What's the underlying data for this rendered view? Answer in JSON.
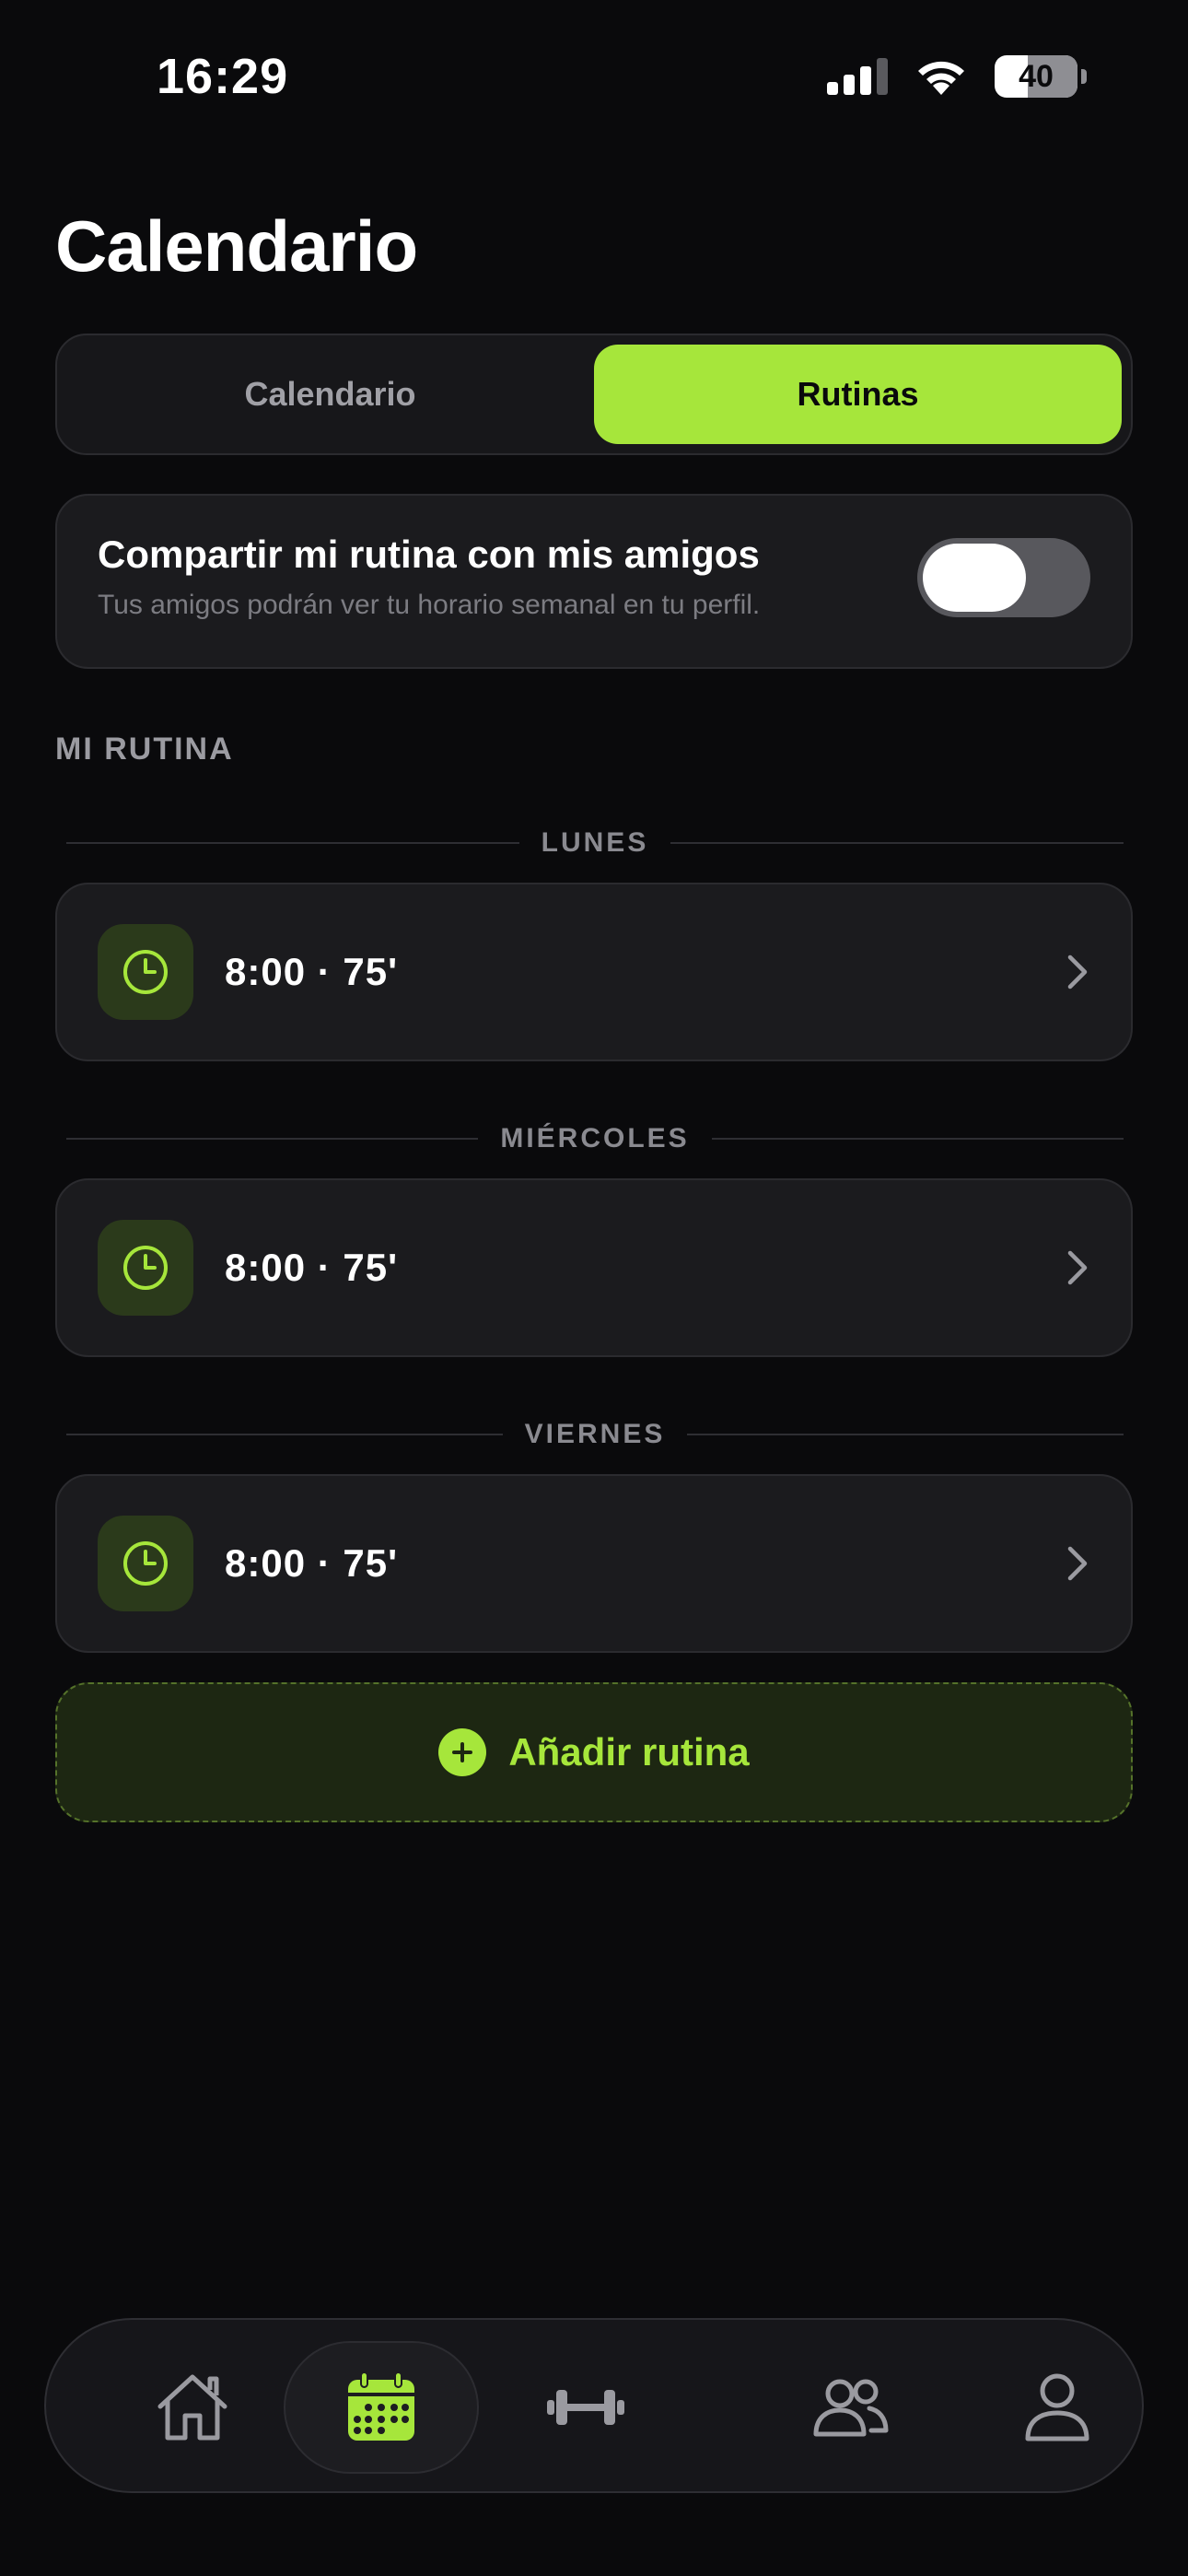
{
  "status_bar": {
    "time": "16:29",
    "battery_percent": "40",
    "battery_level": 40
  },
  "header": {
    "title": "Calendario"
  },
  "segmented": {
    "tabs": [
      {
        "label": "Calendario",
        "active": false
      },
      {
        "label": "Rutinas",
        "active": true
      }
    ]
  },
  "share": {
    "title": "Compartir mi rutina con mis amigos",
    "subtitle": "Tus amigos podrán ver tu horario semanal en tu perfil.",
    "enabled": false
  },
  "routine_section": {
    "label": "MI RUTINA",
    "days": [
      {
        "day": "LUNES",
        "time": "8:00 · 75'"
      },
      {
        "day": "MIÉRCOLES",
        "time": "8:00 · 75'"
      },
      {
        "day": "VIERNES",
        "time": "8:00 · 75'"
      }
    ]
  },
  "add_routine": {
    "label": "Añadir rutina"
  },
  "nav": {
    "items": [
      {
        "icon": "home-icon",
        "active": false
      },
      {
        "icon": "calendar-icon",
        "active": true
      },
      {
        "icon": "dumbbell-icon",
        "active": false
      },
      {
        "icon": "friends-icon",
        "active": false
      },
      {
        "icon": "profile-icon",
        "active": false
      }
    ]
  },
  "colors": {
    "accent": "#a6e63b",
    "background": "#0a0a0c",
    "card": "#1b1b1e"
  }
}
